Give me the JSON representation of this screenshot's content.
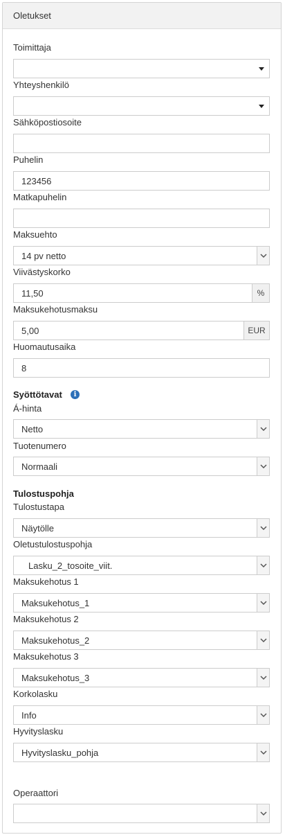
{
  "panel": {
    "title": "Oletukset"
  },
  "labels": {
    "toimittaja": "Toimittaja",
    "yhteyshenkilo": "Yhteyshenkilö",
    "sahkoposti": "Sähköpostiosoite",
    "puhelin": "Puhelin",
    "matkapuhelin": "Matkapuhelin",
    "maksuehto": "Maksuehto",
    "viivastyskorko": "Viivästyskorko",
    "maksukehotusmaksu": "Maksukehotusmaksu",
    "huomautusaika": "Huomautusaika",
    "ahinta": "Á-hinta",
    "tuotenumero": "Tuotenumero",
    "tulostustapa": "Tulostustapa",
    "oletustulostuspohja": "Oletustulostuspohja",
    "maksukehotus1": "Maksukehotus 1",
    "maksukehotus2": "Maksukehotus 2",
    "maksukehotus3": "Maksukehotus 3",
    "korkolasku": "Korkolasku",
    "hyvityslasku": "Hyvityslasku",
    "operaattori": "Operaattori"
  },
  "sections": {
    "syottotavat": "Syöttötavat",
    "tulostuspohja": "Tulostuspohja"
  },
  "values": {
    "toimittaja": "",
    "yhteyshenkilo": "",
    "sahkoposti": "",
    "puhelin": "123456",
    "matkapuhelin": "",
    "maksuehto": "14 pv netto",
    "viivastyskorko": "11,50",
    "viivastyskorko_unit": "%",
    "maksukehotusmaksu": "5,00",
    "maksukehotusmaksu_unit": "EUR",
    "huomautusaika": "8",
    "ahinta": "Netto",
    "tuotenumero": "Normaali",
    "tulostustapa": "Näytölle",
    "oletustulostuspohja": "Lasku_2_tosoite_viit.",
    "maksukehotus1": "Maksukehotus_1",
    "maksukehotus2": "Maksukehotus_2",
    "maksukehotus3": "Maksukehotus_3",
    "korkolasku": "Info",
    "hyvityslasku": "Hyvityslasku_pohja",
    "operaattori": ""
  },
  "icons": {
    "info": "info-icon",
    "info_glyph": "i",
    "info_color": "#2c6fb8"
  }
}
